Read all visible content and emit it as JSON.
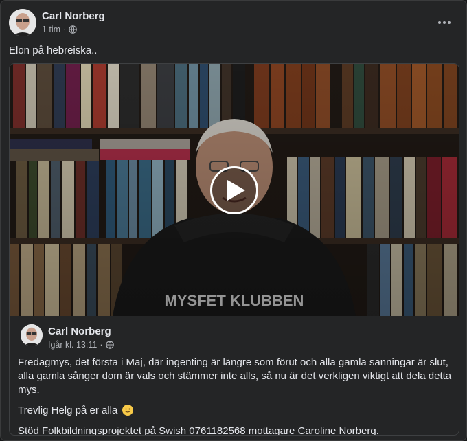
{
  "post": {
    "author": "Carl Norberg",
    "time": "1 tim",
    "text": "Elon på hebreiska.."
  },
  "shared": {
    "author": "Carl Norberg",
    "time": "Igår kl. 13:11",
    "paragraph1": "Fredagmys, det första i Maj, där ingenting är längre som förut och alla gamla sanningar är slut, alla gamla sånger dom är vals och stämmer inte alls, så nu är det verkligen viktigt att dela detta mys.",
    "paragraph2": "Trevlig Helg på er alla",
    "paragraph3": "Stöd Folkbildningsprojektet på Swish 0761182568 mottagare Caroline Norberg.",
    "sweater_text": "MYSFET KLUBBEN"
  },
  "icons": {
    "privacy": "globe-icon",
    "menu": "more-options-icon",
    "play": "play-icon",
    "emoji": "smiling-face-icon"
  },
  "colors": {
    "card_bg": "#242526",
    "text": "#e4e6eb",
    "secondary_text": "#b0b3b8"
  }
}
